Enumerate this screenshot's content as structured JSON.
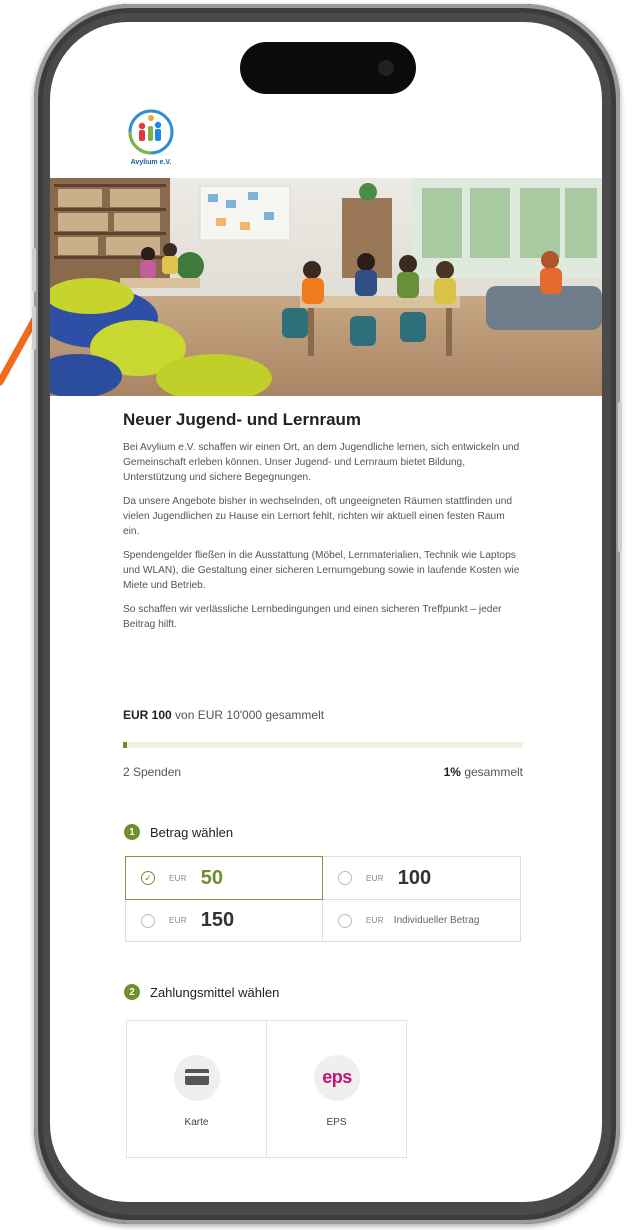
{
  "org": {
    "logo_text": "Avylium e.V."
  },
  "campaign": {
    "title": "Neuer Jugend- und Lernraum",
    "paragraphs": [
      "Bei Avylium e.V. schaffen wir einen Ort, an dem Jugendliche lernen, sich entwickeln und Gemeinschaft erleben können. Unser Jugend- und Lernraum bietet Bildung, Unterstützung und sichere Begegnungen.",
      "Da unsere Angebote bisher in wechselnden, oft ungeeigneten Räumen stattfinden und vielen Jugendlichen zu Hause ein Lernort fehlt, richten wir aktuell einen festen Raum ein.",
      "Spendengelder fließen in die Ausstattung (Möbel, Lernmaterialien, Technik wie Laptops und WLAN), die Gestaltung einer sicheren Lernumgebung sowie in laufende Kosten wie Miete und Betrieb.",
      "So schaffen wir verlässliche Lernbedingungen und einen sicheren Treffpunkt – jeder Beitrag hilft."
    ]
  },
  "progress": {
    "raised_amount": "EUR 100",
    "goal_text": "von EUR 10'000 gesammelt",
    "percent": 1,
    "donations": "2 Spenden",
    "percent_value": "1%",
    "percent_label": "gesammelt"
  },
  "step1": {
    "number": "1",
    "label": "Betrag wählen",
    "currency": "EUR",
    "options": [
      {
        "value": "50",
        "selected": true
      },
      {
        "value": "100",
        "selected": false
      },
      {
        "value": "150",
        "selected": false
      },
      {
        "value": "Individueller Betrag",
        "selected": false
      }
    ]
  },
  "step2": {
    "number": "2",
    "label": "Zahlungsmittel wählen",
    "methods": [
      {
        "label": "Karte",
        "icon": "card-icon"
      },
      {
        "label": "EPS",
        "icon": "eps-icon",
        "logo_text": "eps"
      }
    ]
  },
  "colors": {
    "accent": "#6f8f2f",
    "eps": "#c3146f",
    "arrow": "#f26a1b"
  }
}
